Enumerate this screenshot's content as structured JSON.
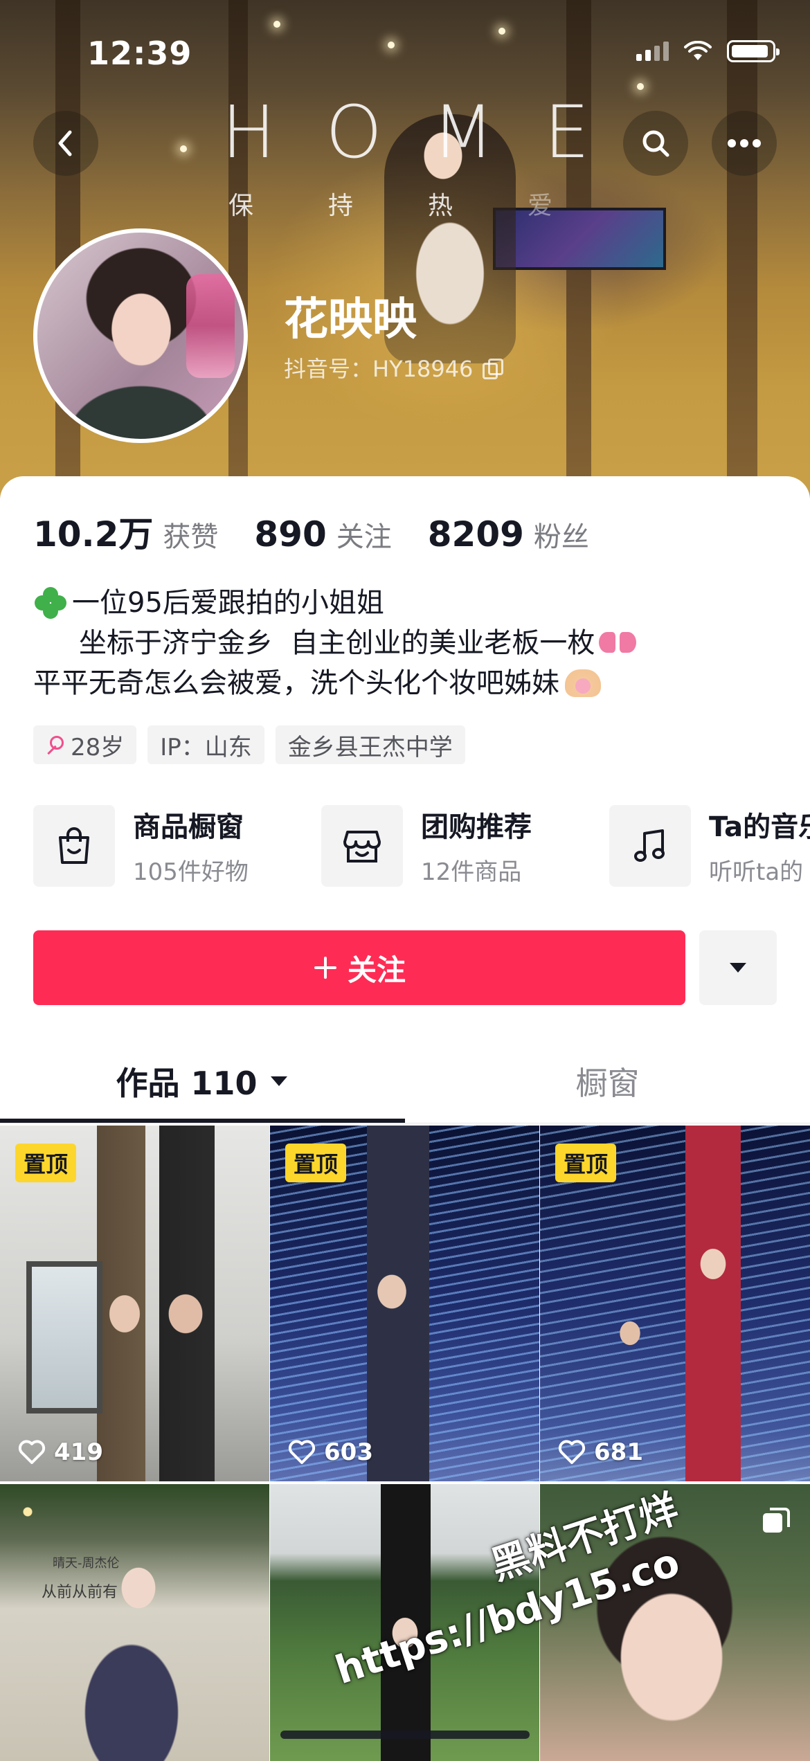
{
  "status_bar": {
    "time": "12:39"
  },
  "header": {
    "cover_title": "HOME",
    "cover_subtitle": [
      "保",
      "持",
      "热",
      "爱"
    ],
    "name": "花映映",
    "douyin_id": "抖音号：HY18946"
  },
  "stats": [
    {
      "value": "10.2万",
      "label": "获赞"
    },
    {
      "value": "890",
      "label": "关注"
    },
    {
      "value": "8209",
      "label": "粉丝"
    }
  ],
  "bio": {
    "line1": "一位95后爱跟拍的小姐姐",
    "line2": "坐标于济宁金乡  自主创业的美业老板一枚",
    "line3": "平平无奇怎么会被爱，洗个头化个妆吧姊妹"
  },
  "tags": {
    "age": "28岁",
    "ip": "IP：山东",
    "school": "金乡县王杰中学"
  },
  "features": [
    {
      "title": "商品橱窗",
      "subtitle": "105件好物",
      "icon": "shopping-bag-icon"
    },
    {
      "title": "团购推荐",
      "subtitle": "12件商品",
      "icon": "store-icon"
    },
    {
      "title": "Ta的音乐",
      "subtitle": "听听ta的",
      "icon": "music-note-icon"
    }
  ],
  "actions": {
    "follow_label": "关注"
  },
  "tabs": {
    "works": "作品 110",
    "showcase": "橱窗"
  },
  "grid": [
    {
      "pinned": "置顶",
      "likes": "419"
    },
    {
      "pinned": "置顶",
      "likes": "603"
    },
    {
      "pinned": "置顶",
      "likes": "681"
    },
    {
      "wall_text": "晴天-周杰伦",
      "wall_text2": "从前从前有"
    }
  ],
  "watermark": {
    "line1": "黑料不打烊",
    "line2": "https://bdy15.co"
  },
  "colors": {
    "primary": "#fe2c55",
    "pin": "#fcd62b",
    "text": "#161823",
    "muted": "#8a8b91"
  }
}
